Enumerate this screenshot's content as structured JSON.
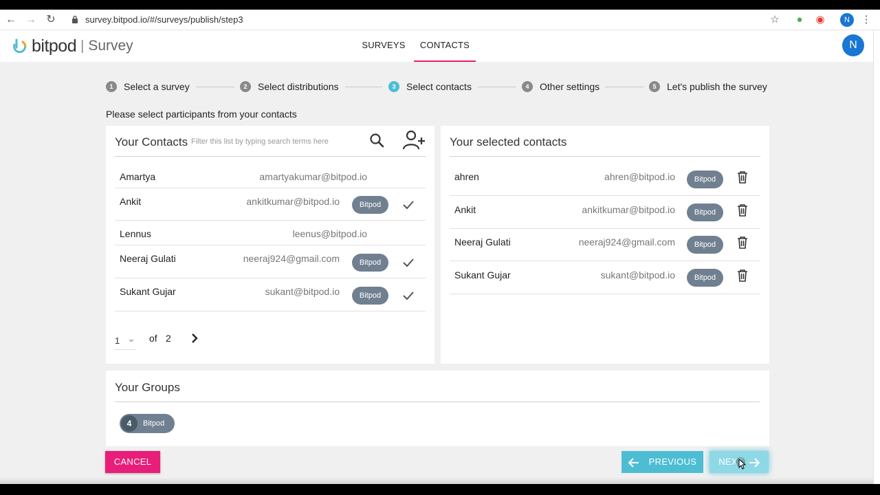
{
  "browser": {
    "url": "survey.bitpod.io/#/surveys/publish/step3",
    "profile_initial": "N"
  },
  "header": {
    "logo_text": "bitpod",
    "logo_separator": "|",
    "logo_sub": "Survey",
    "tabs": [
      {
        "label": "SURVEYS",
        "active": false
      },
      {
        "label": "CONTACTS",
        "active": true
      }
    ],
    "user_initial": "N",
    "accent_color": "#e91e63"
  },
  "stepper": {
    "steps": [
      {
        "num": "1",
        "label": "Select a survey",
        "active": false
      },
      {
        "num": "2",
        "label": "Select distributions",
        "active": false
      },
      {
        "num": "3",
        "label": "Select contacts",
        "active": true
      },
      {
        "num": "4",
        "label": "Other settings",
        "active": false
      },
      {
        "num": "5",
        "label": "Let's publish the survey",
        "active": false
      }
    ],
    "active_color": "#4dbdd4"
  },
  "instruction": "Please select participants from your contacts",
  "contacts": {
    "title": "Your Contacts",
    "filter_placeholder": "Filter this list by typing search terms here",
    "rows": [
      {
        "name": "Amartya",
        "email": "amartyakumar@bitpod.io",
        "tag": "",
        "selected": false
      },
      {
        "name": "Ankit",
        "email": "ankitkumar@bitpod.io",
        "tag": "Bitpod",
        "selected": true
      },
      {
        "name": "Lennus",
        "email": "leenus@bitpod.io",
        "tag": "",
        "selected": false
      },
      {
        "name": "Neeraj Gulati",
        "email": "neeraj924@gmail.com",
        "tag": "Bitpod",
        "selected": true
      },
      {
        "name": "Sukant Gujar",
        "email": "sukant@bitpod.io",
        "tag": "Bitpod",
        "selected": true
      }
    ],
    "pager": {
      "page": "1",
      "of_label": "of",
      "total": "2"
    }
  },
  "selected": {
    "title": "Your selected contacts",
    "rows": [
      {
        "name": "ahren",
        "email": "ahren@bitpod.io",
        "tag": "Bitpod"
      },
      {
        "name": "Ankit",
        "email": "ankitkumar@bitpod.io",
        "tag": "Bitpod"
      },
      {
        "name": "Neeraj Gulati",
        "email": "neeraj924@gmail.com",
        "tag": "Bitpod"
      },
      {
        "name": "Sukant Gujar",
        "email": "sukant@bitpod.io",
        "tag": "Bitpod"
      }
    ]
  },
  "groups": {
    "title": "Your Groups",
    "items": [
      {
        "count": "4",
        "label": "Bitpod"
      }
    ]
  },
  "footer": {
    "cancel_label": "CANCEL",
    "previous_label": "PREVIOUS",
    "next_label": "NEXT",
    "cancel_color": "#e91e7a",
    "primary_color": "#4dbdd4"
  }
}
